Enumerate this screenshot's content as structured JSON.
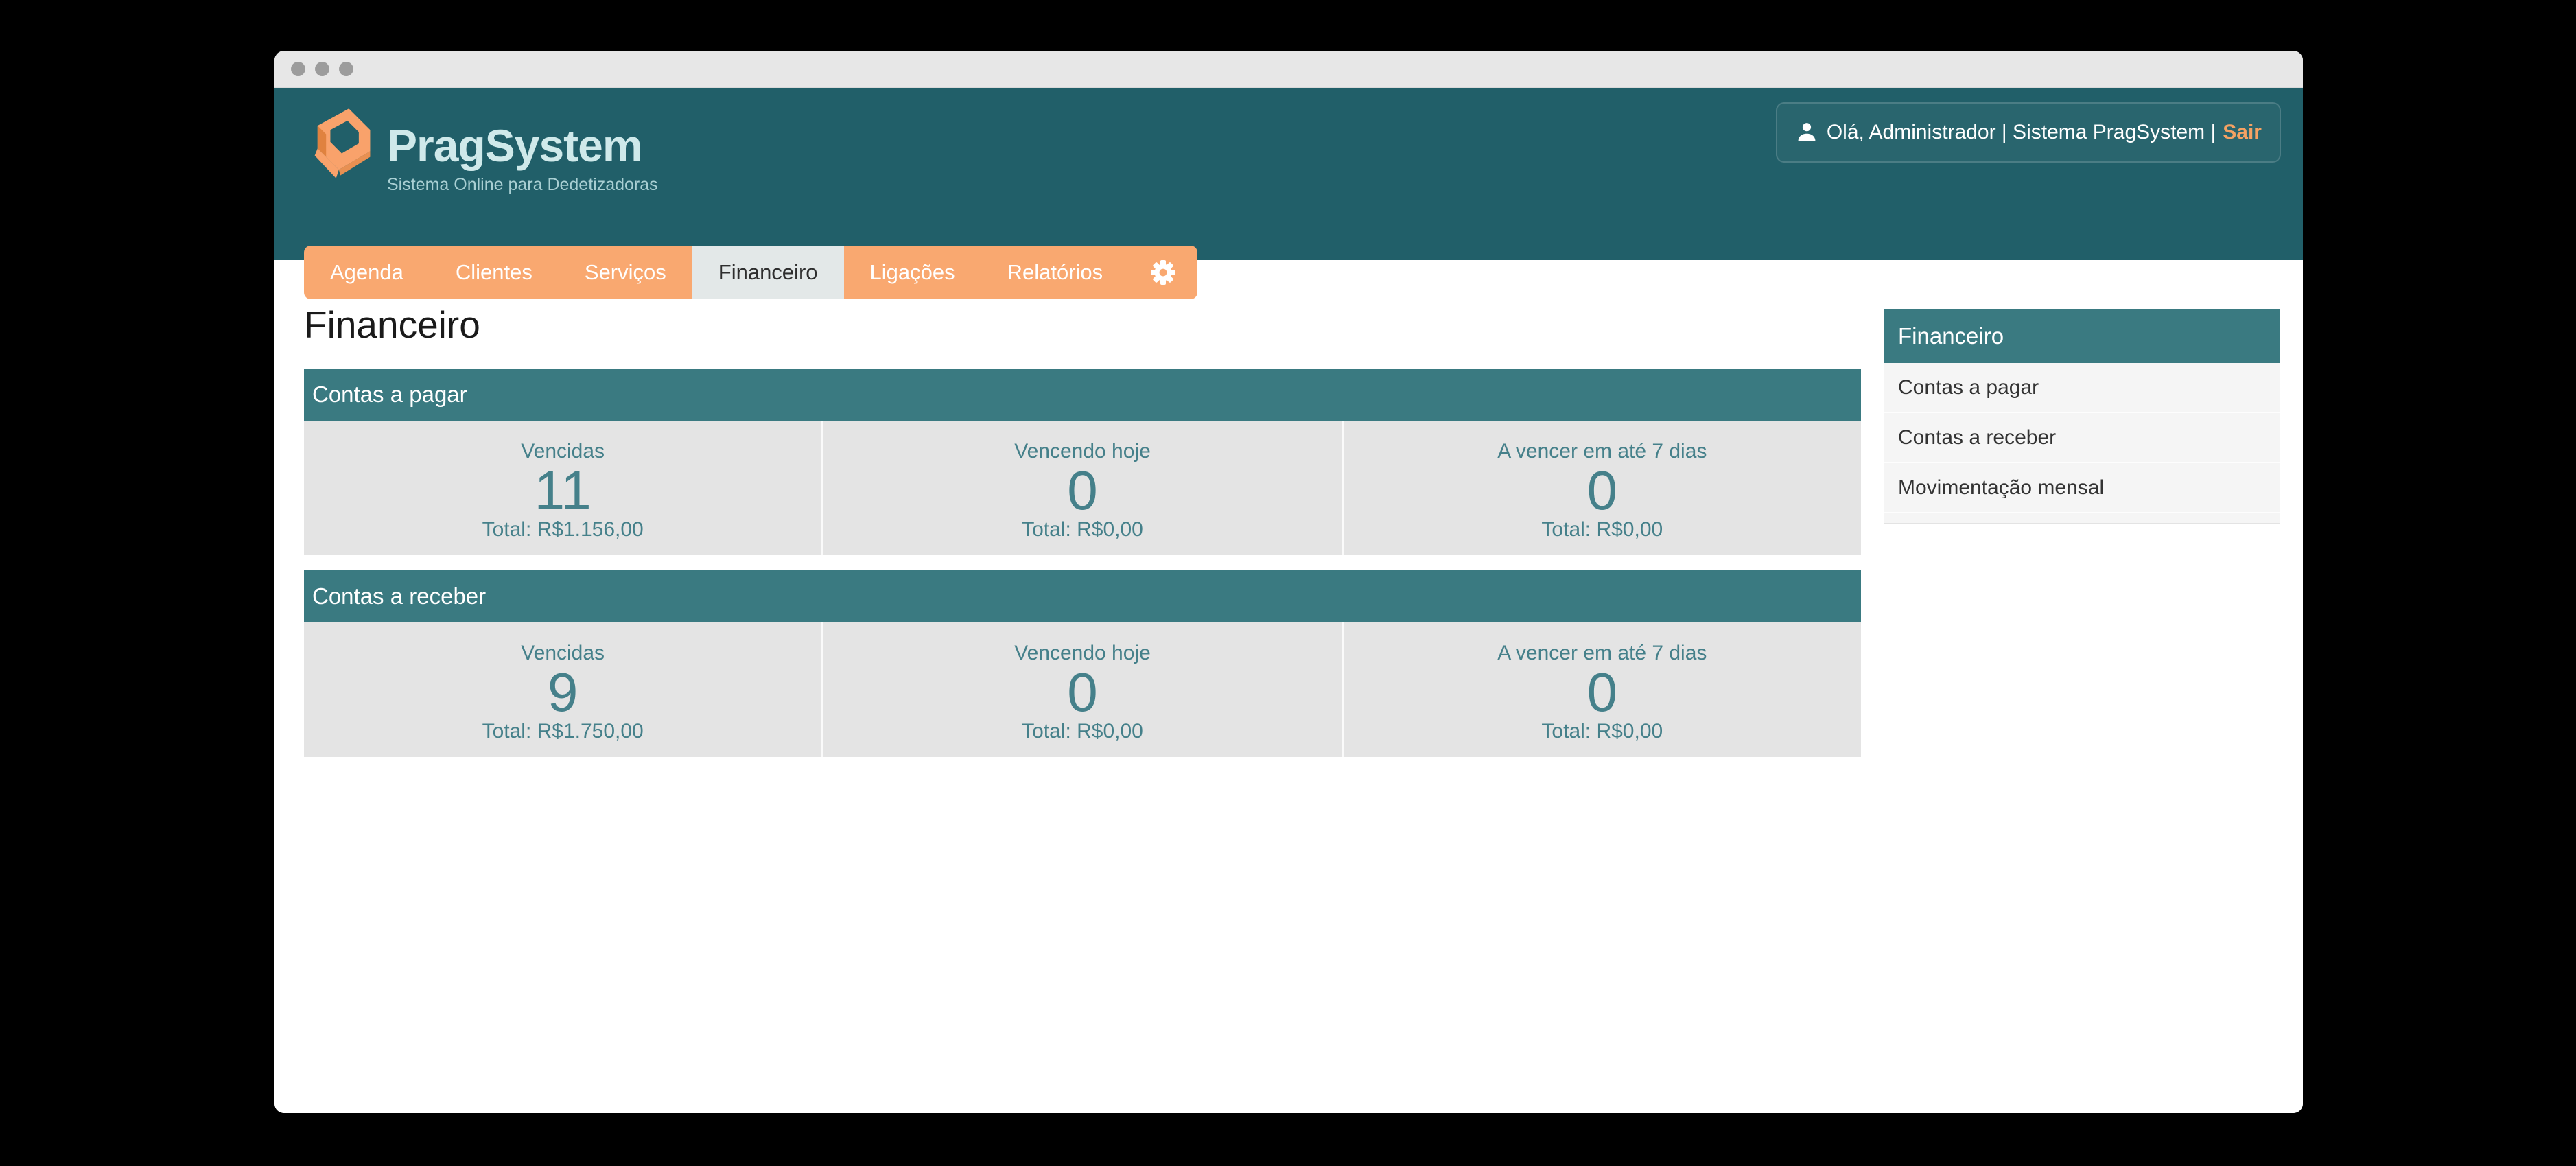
{
  "header": {
    "logo_title": "PragSystem",
    "logo_subtitle": "Sistema Online para Dedetizadoras",
    "user_greeting": "Olá, Administrador | Sistema PragSystem |",
    "logout_label": "Sair"
  },
  "nav": {
    "tabs": [
      {
        "label": "Agenda",
        "active": false
      },
      {
        "label": "Clientes",
        "active": false
      },
      {
        "label": "Serviços",
        "active": false
      },
      {
        "label": "Financeiro",
        "active": true
      },
      {
        "label": "Ligações",
        "active": false
      },
      {
        "label": "Relatórios",
        "active": false
      }
    ],
    "gear_icon": "settings"
  },
  "page": {
    "title": "Financeiro"
  },
  "panels": [
    {
      "title": "Contas a pagar",
      "columns": [
        {
          "label": "Vencidas",
          "value": "11",
          "total": "Total: R$1.156,00"
        },
        {
          "label": "Vencendo hoje",
          "value": "0",
          "total": "Total: R$0,00"
        },
        {
          "label": "A vencer em até 7 dias",
          "value": "0",
          "total": "Total: R$0,00"
        }
      ]
    },
    {
      "title": "Contas a receber",
      "columns": [
        {
          "label": "Vencidas",
          "value": "9",
          "total": "Total: R$1.750,00"
        },
        {
          "label": "Vencendo hoje",
          "value": "0",
          "total": "Total: R$0,00"
        },
        {
          "label": "A vencer em até 7 dias",
          "value": "0",
          "total": "Total: R$0,00"
        }
      ]
    }
  ],
  "sidebar": {
    "title": "Financeiro",
    "items": [
      "Contas a pagar",
      "Contas a receber",
      "Movimentação mensal"
    ]
  },
  "colors": {
    "header_teal": "#215f69",
    "panel_teal": "#3a7a81",
    "accent_orange": "#f9a870",
    "value_teal": "#45808a"
  }
}
